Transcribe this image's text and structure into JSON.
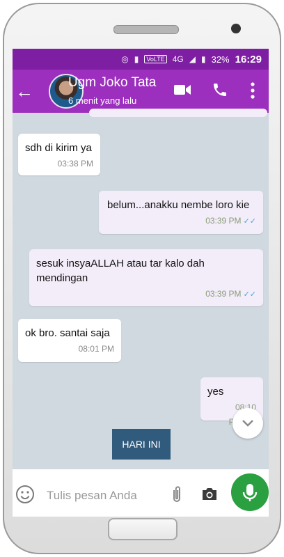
{
  "status_bar": {
    "battery": "32%",
    "time": "16:29",
    "network_label": "VoLTE",
    "signal_4g": "4G"
  },
  "header": {
    "contact_name": "Ugm Joko Tata",
    "last_seen": "6 menit yang lalu",
    "accent_color": "#9c2fbd"
  },
  "messages": [
    {
      "text": "sdh di kirim ya",
      "time": "03:38 PM",
      "direction": "in"
    },
    {
      "text": "belum...anakku nembe loro kie",
      "time": "03:39 PM",
      "direction": "out",
      "read": true
    },
    {
      "text": "sesuk insyaALLAH atau tar kalo dah mendingan",
      "time": "03:39 PM",
      "direction": "out",
      "read": true
    },
    {
      "text": "ok bro. santai saja",
      "time": "08:01 PM",
      "direction": "in"
    },
    {
      "text": "yes",
      "time": "08:10 PM",
      "direction": "out",
      "read": true
    }
  ],
  "date_chip": "HARI INI",
  "input": {
    "placeholder": "Tulis pesan Anda"
  },
  "icons": [
    "back-arrow-icon",
    "video-call-icon",
    "phone-call-icon",
    "more-vert-icon",
    "scroll-down-icon",
    "emoji-icon",
    "attachment-icon",
    "camera-icon",
    "mic-icon",
    "double-check-icon"
  ]
}
